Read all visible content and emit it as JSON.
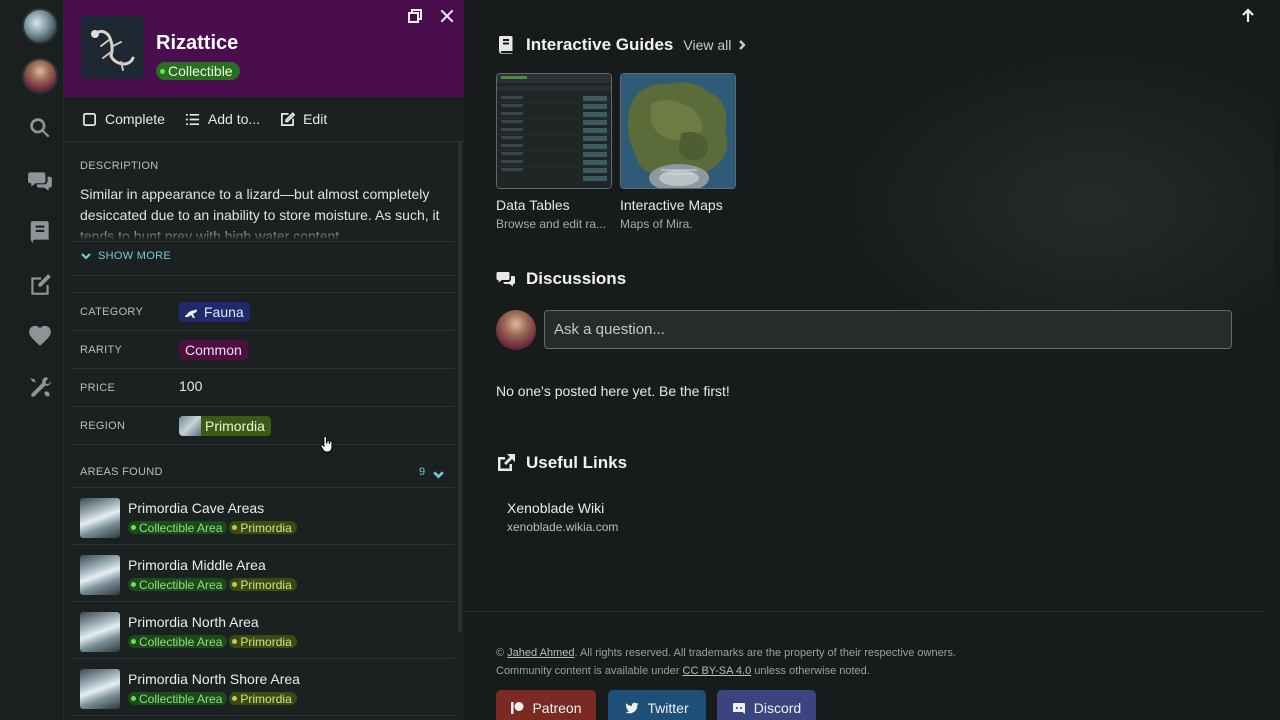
{
  "panel": {
    "title": "Rizattice",
    "type_badge": "Collectible",
    "actions": {
      "complete": "Complete",
      "add_to": "Add to...",
      "edit": "Edit"
    },
    "description": {
      "label": "DESCRIPTION",
      "text": "Similar in appearance to a lizard—but almost completely desiccated due to an inability to store moisture. As such, it tends to hunt prey with high water content.",
      "show_more": "SHOW MORE"
    },
    "properties": {
      "category": {
        "label": "CATEGORY",
        "value": "Fauna"
      },
      "rarity": {
        "label": "RARITY",
        "value": "Common"
      },
      "price": {
        "label": "PRICE",
        "value": "100"
      },
      "region": {
        "label": "REGION",
        "value": "Primordia"
      }
    },
    "areas": {
      "label": "AREAS FOUND",
      "count": "9",
      "items": [
        {
          "name": "Primordia Cave Areas",
          "tag1": "Collectible Area",
          "tag2": "Primordia"
        },
        {
          "name": "Primordia Middle Area",
          "tag1": "Collectible Area",
          "tag2": "Primordia"
        },
        {
          "name": "Primordia North Area",
          "tag1": "Collectible Area",
          "tag2": "Primordia"
        },
        {
          "name": "Primordia North Shore Area",
          "tag1": "Collectible Area",
          "tag2": "Primordia"
        }
      ]
    },
    "colors": {
      "header_bg": "#4a0d4d",
      "collectible_green": "#2a6e1f",
      "fauna_blue": "#1f2a6b",
      "common_purple": "#4c0f3f",
      "region_green": "#3b5a16"
    }
  },
  "guides": {
    "title": "Interactive Guides",
    "view_all": "View all",
    "items": [
      {
        "title": "Data Tables",
        "subtitle": "Browse and edit ra..."
      },
      {
        "title": "Interactive Maps",
        "subtitle": "Maps of Mira."
      }
    ]
  },
  "discussions": {
    "title": "Discussions",
    "placeholder": "Ask a question...",
    "empty": "No one's posted here yet. Be the first!"
  },
  "links": {
    "title": "Useful Links",
    "items": [
      {
        "title": "Xenoblade Wiki",
        "url": "xenoblade.wikia.com"
      }
    ]
  },
  "footer": {
    "copyright_prefix": "©",
    "author": "Jahed Ahmed",
    "rights": ". All rights reserved. All trademarks are the property of their respective owners.",
    "community_prefix": "Community content is available under",
    "license": "CC BY-SA 4.0",
    "community_suffix": "unless otherwise noted.",
    "social": {
      "patreon": "Patreon",
      "twitter": "Twitter",
      "discord": "Discord"
    },
    "social_colors": {
      "patreon": "#7a2a22",
      "twitter": "#1d4f78",
      "discord": "#3c4480"
    }
  }
}
